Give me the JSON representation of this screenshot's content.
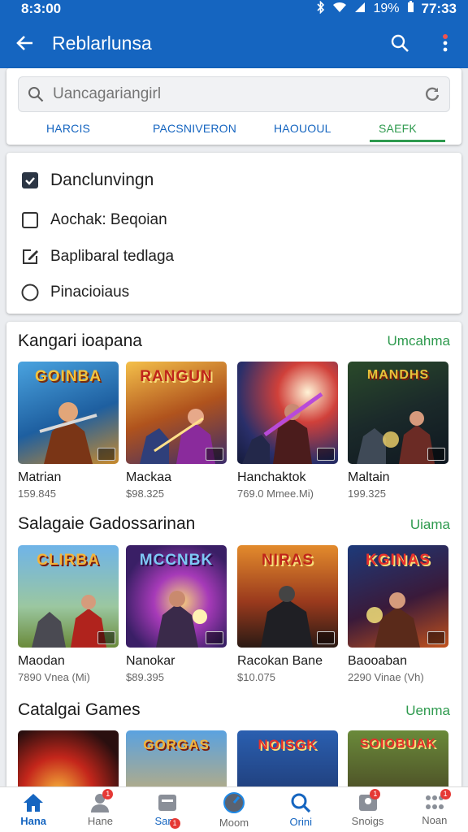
{
  "status_bar": {
    "time_left": "8:3:00",
    "battery": "19%",
    "time_right": "77:33"
  },
  "app_bar": {
    "title": "Reblarlunsa"
  },
  "search": {
    "placeholder": "Uancagariangirl"
  },
  "tabs": [
    {
      "label": "HARCIS"
    },
    {
      "label": "Pacsniveron"
    },
    {
      "label": "Haououl"
    },
    {
      "label": "SAEFK"
    }
  ],
  "filters": {
    "heading": "Danclunvingn",
    "options": [
      {
        "label": "Aochak: Beqoian"
      },
      {
        "label": "Baplibaral tedlaga"
      },
      {
        "label": "Pinacioiaus"
      }
    ]
  },
  "sections": [
    {
      "title": "Kangari ioapana",
      "more": "Umcahma",
      "items": [
        {
          "logo": "GOINBA",
          "name": "Matrian",
          "meta": "159.845",
          "theme": "blue"
        },
        {
          "logo": "RANGUN",
          "name": "Mackaa",
          "meta": "$98.325",
          "theme": "gold"
        },
        {
          "logo": "",
          "name": "Hanchaktok",
          "meta": "769.0 Mmee.Mi)",
          "theme": "red"
        },
        {
          "logo": "MANDHS",
          "name": "Maltain",
          "meta": "199.325",
          "theme": "green"
        }
      ]
    },
    {
      "title": "Salagaie Gadossarinan",
      "more": "Uiama",
      "items": [
        {
          "logo": "CLIRBA",
          "name": "Maodan",
          "meta": "7890 Vnea (Mi)",
          "theme": "sky"
        },
        {
          "logo": "MCCNBK",
          "name": "Nanokar",
          "meta": "$89.395",
          "theme": "purple"
        },
        {
          "logo": "NIRAS",
          "name": "Racokan Bane",
          "meta": "$10.075",
          "theme": "orange"
        },
        {
          "logo": "KGINAS",
          "name": "Baooaban",
          "meta": "2290 Vinae (Vh)",
          "theme": "navy"
        }
      ]
    },
    {
      "title": "Catalgai Games",
      "more": "Uenma",
      "items": [
        {
          "logo": "",
          "name": "",
          "meta": "",
          "theme": "fire"
        },
        {
          "logo": "GORGAS",
          "name": "",
          "meta": "",
          "theme": "sky"
        },
        {
          "logo": "NOISGK",
          "name": "",
          "meta": "",
          "theme": "blue"
        },
        {
          "logo": "SOIOBUAK",
          "name": "",
          "meta": "",
          "theme": "gold"
        }
      ]
    }
  ],
  "nav": [
    {
      "label": "Hana",
      "badge": ""
    },
    {
      "label": "Hane",
      "badge": "1"
    },
    {
      "label": "Sann",
      "badge": "1"
    },
    {
      "label": "Moom",
      "badge": ""
    },
    {
      "label": "Orini",
      "badge": ""
    },
    {
      "label": "Snoigs",
      "badge": "1"
    },
    {
      "label": "Noan",
      "badge": "1"
    }
  ],
  "colors": {
    "primary": "#1565c0",
    "accent": "#2e9a4e",
    "badge": "#e53935"
  }
}
